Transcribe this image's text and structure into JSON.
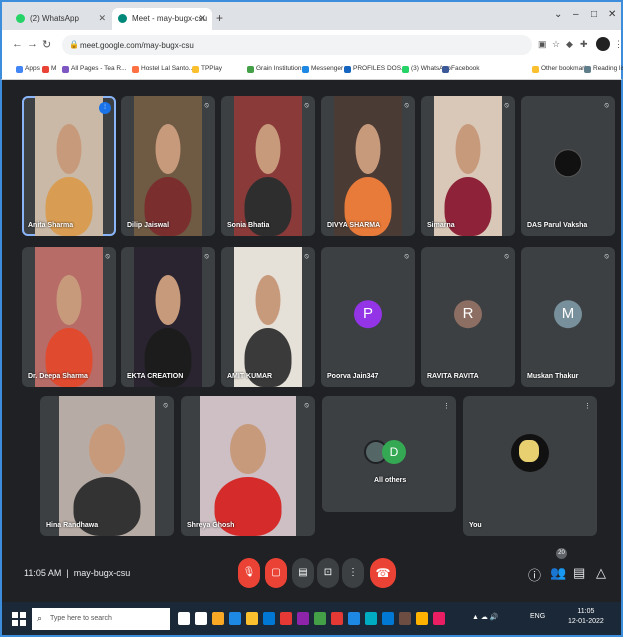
{
  "browser": {
    "tabs": [
      {
        "label": "(2) WhatsApp",
        "active": false,
        "favicon_color": "#25d366"
      },
      {
        "label": "Meet - may-bugx-csu",
        "active": true,
        "favicon_color": "#00897b"
      }
    ],
    "new_tab": "+",
    "url": "meet.google.com/may-bugx-csu",
    "bookmarks": [
      {
        "label": "Apps",
        "color": "#4285f4"
      },
      {
        "label": "M",
        "color": "#ea4335"
      },
      {
        "label": "All Pages - Tea R...",
        "color": "#7e57c2"
      },
      {
        "label": "Hostel Lal Santo...",
        "color": "#ff7043"
      },
      {
        "label": "TPPlay",
        "color": "#fbc02d"
      },
      {
        "label": "Grain Institutions",
        "color": "#43a047"
      },
      {
        "label": "Messenger",
        "color": "#1e88e5"
      },
      {
        "label": "PROFILES DOS...",
        "color": "#1565c0"
      },
      {
        "label": "(3) WhatsApp",
        "color": "#25d366"
      },
      {
        "label": "Facebook",
        "color": "#3b5998"
      },
      {
        "label": "Other bookmarks",
        "color": "#fbc02d"
      },
      {
        "label": "Reading list",
        "color": "#607d8b"
      }
    ]
  },
  "participants_row1": [
    {
      "name": "Anita Sharma",
      "video": true,
      "mic_icon": "mic-on-icon",
      "speaking": true,
      "bg": "#c9b9a6",
      "shirt": "#d89c52"
    },
    {
      "name": "Dilip Jaiswal",
      "video": true,
      "mic_icon": "mic-off-icon",
      "bg": "#6f5a44",
      "shirt": "#7a2e2e"
    },
    {
      "name": "Sonia Bhatia",
      "video": true,
      "mic_icon": "mic-off-icon",
      "bg": "#8b3a3a",
      "shirt": "#2e2e2e"
    },
    {
      "name": "DIVYA SHARMA",
      "video": true,
      "mic_icon": "mic-off-icon",
      "bg": "#4a3b35",
      "shirt": "#e87a3a"
    },
    {
      "name": "Simarna",
      "video": true,
      "mic_icon": "mic-off-icon",
      "bg": "#d9c8b8",
      "shirt": "#8e2238"
    },
    {
      "name": "DAS Parul Vaksha",
      "video": false,
      "mic_icon": "mic-off-icon",
      "avatar_style": "photo"
    }
  ],
  "participants_row2": [
    {
      "name": "Dr. Deepa Sharma",
      "video": true,
      "mic_icon": "mic-off-icon",
      "bg": "#b76c68",
      "shirt": "#e04a2e"
    },
    {
      "name": "EKTA CREATION",
      "video": true,
      "mic_icon": "mic-off-icon",
      "bg": "#2a2430",
      "shirt": "#1c1c1c"
    },
    {
      "name": "AMIT KUMAR",
      "video": true,
      "mic_icon": "mic-off-icon",
      "bg": "#e5e0d8",
      "shirt": "#3a3a3a"
    },
    {
      "name": "Poorva Jain347",
      "video": false,
      "mic_icon": "mic-off-icon",
      "initial": "P",
      "avatar_color": "#9334e6"
    },
    {
      "name": "RAVITA RAVITA",
      "video": false,
      "mic_icon": "mic-off-icon",
      "initial": "R",
      "avatar_color": "#8d6e63"
    },
    {
      "name": "Muskan Thakur",
      "video": false,
      "mic_icon": "mic-off-icon",
      "initial": "M",
      "avatar_color": "#78909c"
    }
  ],
  "participants_row3": [
    {
      "name": "Hina Randhawa",
      "video": true,
      "mic_icon": "mic-off-icon",
      "bg": "#b7aca5",
      "shirt": "#333"
    },
    {
      "name": "Shreya Ghosh",
      "video": true,
      "mic_icon": "mic-off-icon",
      "bg": "#cdbfc4",
      "shirt": "#d52b2b"
    }
  ],
  "others_tile": {
    "label": "All others",
    "initial": "D",
    "avatar_color": "#34a853"
  },
  "self_tile": {
    "label": "You"
  },
  "bottom": {
    "time": "11:05 AM",
    "meeting_code": "may-bugx-csu",
    "participant_count": "20"
  },
  "taskbar": {
    "search_placeholder": "Type here to search",
    "time": "11:05",
    "date": "12-01-2022",
    "lang": "ENG"
  }
}
